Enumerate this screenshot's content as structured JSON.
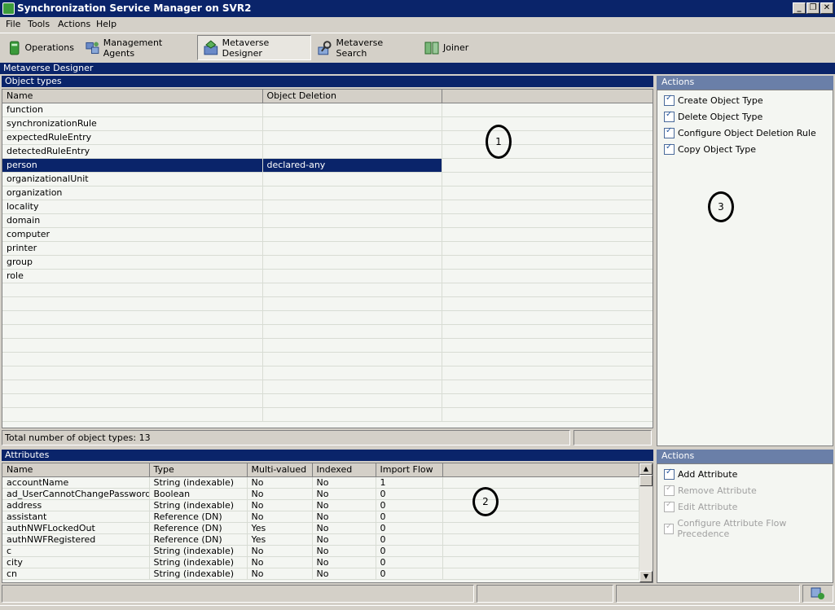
{
  "window": {
    "title": "Synchronization Service Manager on SVR2",
    "controls": [
      "_",
      "❐",
      "✕"
    ]
  },
  "menu": [
    "File",
    "Tools",
    "Actions",
    "Help"
  ],
  "toolbar": {
    "buttons": [
      {
        "label": "Operations",
        "icon": "operations-icon"
      },
      {
        "label": "Management Agents",
        "icon": "management-agents-icon"
      },
      {
        "label": "Metaverse Designer",
        "icon": "metaverse-designer-icon",
        "active": true
      },
      {
        "label": "Metaverse Search",
        "icon": "metaverse-search-icon"
      },
      {
        "label": "Joiner",
        "icon": "joiner-icon"
      }
    ]
  },
  "view_title": "Metaverse Designer",
  "object_types": {
    "header": "Object types",
    "columns": [
      "Name",
      "Object Deletion",
      ""
    ],
    "rows": [
      [
        "function",
        ""
      ],
      [
        "synchronizationRule",
        ""
      ],
      [
        "expectedRuleEntry",
        ""
      ],
      [
        "detectedRuleEntry",
        ""
      ],
      [
        "person",
        "declared-any"
      ],
      [
        "organizationalUnit",
        ""
      ],
      [
        "organization",
        ""
      ],
      [
        "locality",
        ""
      ],
      [
        "domain",
        ""
      ],
      [
        "computer",
        ""
      ],
      [
        "printer",
        ""
      ],
      [
        "group",
        ""
      ],
      [
        "role",
        ""
      ]
    ],
    "selected_row": 4,
    "total": "Total number of object types: 13"
  },
  "attributes": {
    "header": "Attributes",
    "columns": [
      "Name",
      "Type",
      "Multi-valued",
      "Indexed",
      "Import Flow",
      ""
    ],
    "rows": [
      [
        "accountName",
        "String (indexable)",
        "No",
        "No",
        "1"
      ],
      [
        "ad_UserCannotChangePassword",
        "Boolean",
        "No",
        "No",
        "0"
      ],
      [
        "address",
        "String (indexable)",
        "No",
        "No",
        "0"
      ],
      [
        "assistant",
        "Reference (DN)",
        "No",
        "No",
        "0"
      ],
      [
        "authNWFLockedOut",
        "Reference (DN)",
        "Yes",
        "No",
        "0"
      ],
      [
        "authNWFRegistered",
        "Reference (DN)",
        "Yes",
        "No",
        "0"
      ],
      [
        "c",
        "String (indexable)",
        "No",
        "No",
        "0"
      ],
      [
        "city",
        "String (indexable)",
        "No",
        "No",
        "0"
      ],
      [
        "cn",
        "String (indexable)",
        "No",
        "No",
        "0"
      ]
    ]
  },
  "actions_top": {
    "header": "Actions",
    "items": [
      {
        "label": "Create Object Type",
        "enabled": true
      },
      {
        "label": "Delete Object Type",
        "enabled": true
      },
      {
        "label": "Configure Object Deletion Rule",
        "enabled": true
      },
      {
        "label": "Copy Object Type",
        "enabled": true
      }
    ]
  },
  "actions_bottom": {
    "header": "Actions",
    "items": [
      {
        "label": "Add Attribute",
        "enabled": true
      },
      {
        "label": "Remove Attribute",
        "enabled": false
      },
      {
        "label": "Edit Attribute",
        "enabled": false
      },
      {
        "label": "Configure Attribute Flow Precedence",
        "enabled": false
      }
    ]
  },
  "callouts": [
    "1",
    "2",
    "3"
  ]
}
